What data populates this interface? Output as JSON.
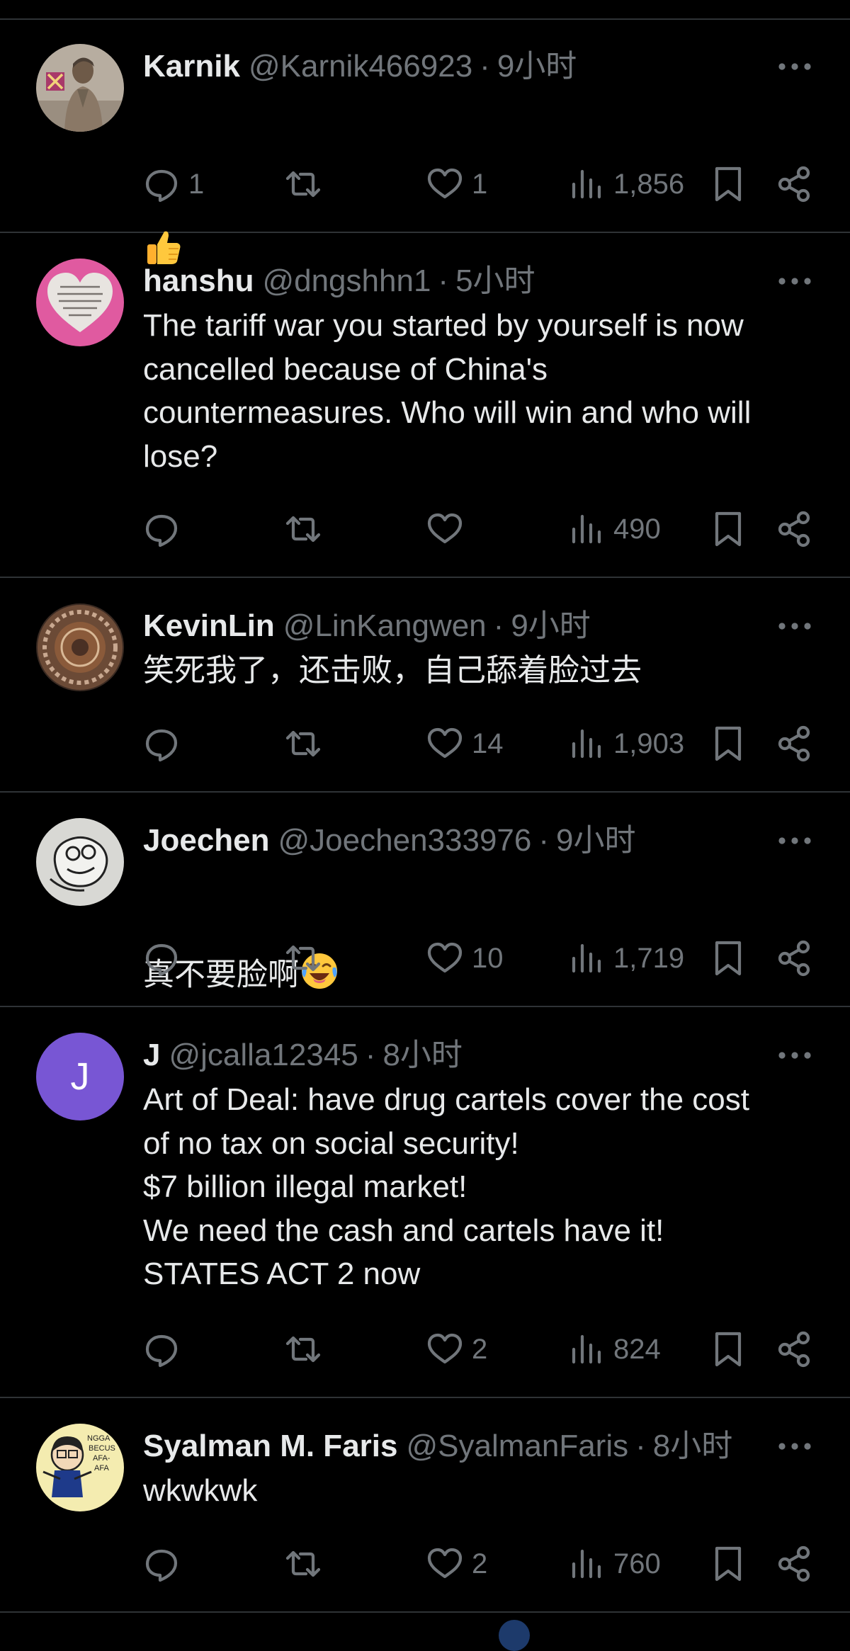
{
  "colors": {
    "background": "#000000",
    "divider": "#2f3336",
    "primary_text": "#e7e9ea",
    "secondary_text": "#71767b",
    "j_avatar": "#7856d4"
  },
  "icons": {
    "reply": "comment-bubble-icon",
    "retweet": "retweet-icon",
    "like": "heart-icon",
    "views": "bar-chart-icon",
    "bookmark": "bookmark-icon",
    "share": "share-icon",
    "more": "more-horizontal-icon"
  },
  "tweets": [
    {
      "name": "Karnik",
      "handle": "@Karnik466923",
      "separator": "·",
      "time": "9小时",
      "text": "",
      "emoji": "thumbs-up",
      "replies": "1",
      "likes": "1",
      "views": "1,856"
    },
    {
      "name": "hanshu",
      "handle": "@dngshhn1",
      "separator": "·",
      "time": "5小时",
      "text": "The tariff war you started by yourself is now\ncancelled because of China's\ncountermeasures. Who will win and who will\nlose?",
      "replies": "",
      "likes": "",
      "views": "490"
    },
    {
      "name": "KevinLin",
      "handle": "@LinKangwen",
      "separator": "·",
      "time": "9小时",
      "text": "笑死我了，还击败，自己舔着脸过去",
      "replies": "",
      "likes": "14",
      "views": "1,903"
    },
    {
      "name": "Joechen",
      "handle": "@Joechen333976",
      "separator": "·",
      "time": "9小时",
      "text": "真不要脸啊",
      "emoji": "face-with-tears-of-joy",
      "replies": "",
      "likes": "10",
      "views": "1,719"
    },
    {
      "name": "J",
      "handle": "@jcalla12345",
      "separator": "·",
      "time": "8小时",
      "avatar_letter": "J",
      "text": "Art of Deal: have drug cartels cover the cost\nof no tax on social security!\n$7 billion illegal market!\nWe need the cash and cartels have it!\nSTATES ACT 2 now",
      "replies": "",
      "likes": "2",
      "views": "824"
    },
    {
      "name": "Syalman M. Faris",
      "handle": "@SyalmanFaris",
      "separator": "·",
      "time": "8小时",
      "text": "wkwkwk",
      "avatar_text": [
        "NGGA",
        "BECUS",
        "AFA-",
        "AFA"
      ],
      "replies": "",
      "likes": "2",
      "views": "760"
    }
  ]
}
